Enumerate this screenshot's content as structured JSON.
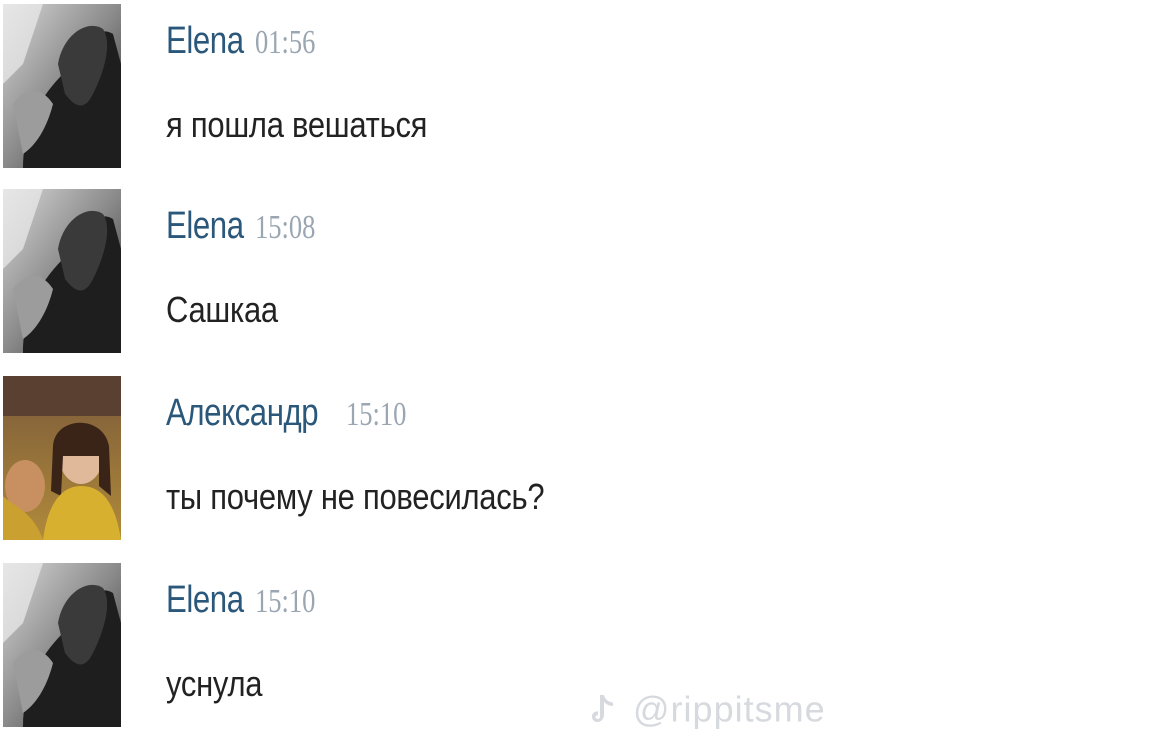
{
  "messages": [
    {
      "author": "Elena",
      "time": "01:56",
      "text": "я пошла вешаться",
      "avatar": "elena-photo"
    },
    {
      "author": "Elena",
      "time": "15:08",
      "text": "Сашкаа",
      "avatar": "elena-photo"
    },
    {
      "author": "Александр",
      "time": "15:10",
      "text": "ты почему не повесилась?",
      "avatar": "alexander-photo"
    },
    {
      "author": "Elena",
      "time": "15:10",
      "text": "уснула",
      "avatar": "elena-photo"
    }
  ],
  "watermark": {
    "icon": "tiktok-icon",
    "handle": "@rippitsme"
  },
  "colors": {
    "author": "#2b587a",
    "time": "#9aa6b2",
    "text": "#222222",
    "background": "#ffffff"
  }
}
